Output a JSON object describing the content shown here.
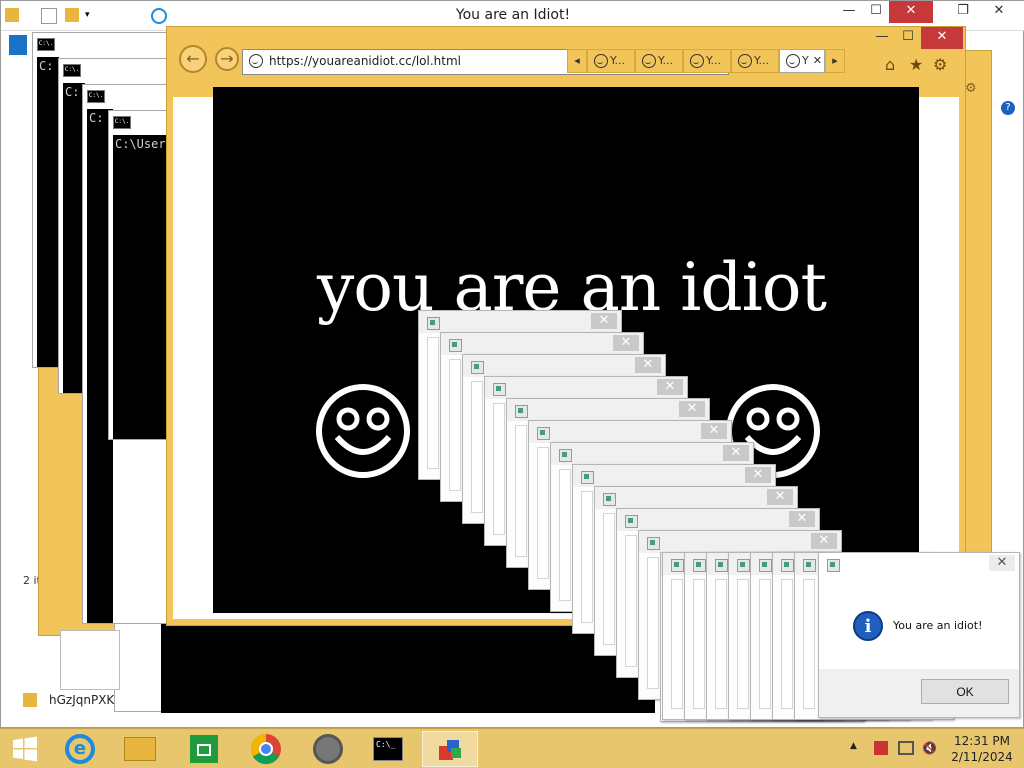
{
  "explorer": {
    "title": "You are an Idiot!",
    "status": "2 it",
    "file_name": "hGzJqnPXK"
  },
  "caption": {
    "minimize": "—",
    "maximize": "☐",
    "close": "✕",
    "restore": "❐"
  },
  "cmd_windows": {
    "icon_text": "C:\\.",
    "prompt_short": "C:",
    "prompt_full": "C:\\User"
  },
  "browser": {
    "url": "https://youareanidiot.cc/lol.html",
    "tab_label": "Y...",
    "tab_active_label": "Y",
    "tab_close": "✕",
    "page_text": "you are an idiot"
  },
  "popup_dialog": {
    "message": "You are an idiot!",
    "ok_label": "OK",
    "close_symbol": "✕"
  },
  "taskbar": {
    "time": "12:31 PM",
    "date": "2/11/2024",
    "tray_chevron": "▲",
    "cmd_icon_text": "C:\\_"
  },
  "colors": {
    "ie_frame": "#f2c55b",
    "taskbar": "#e8c66e",
    "close_red": "#c7383a",
    "info_blue": "#1f5fbf"
  }
}
